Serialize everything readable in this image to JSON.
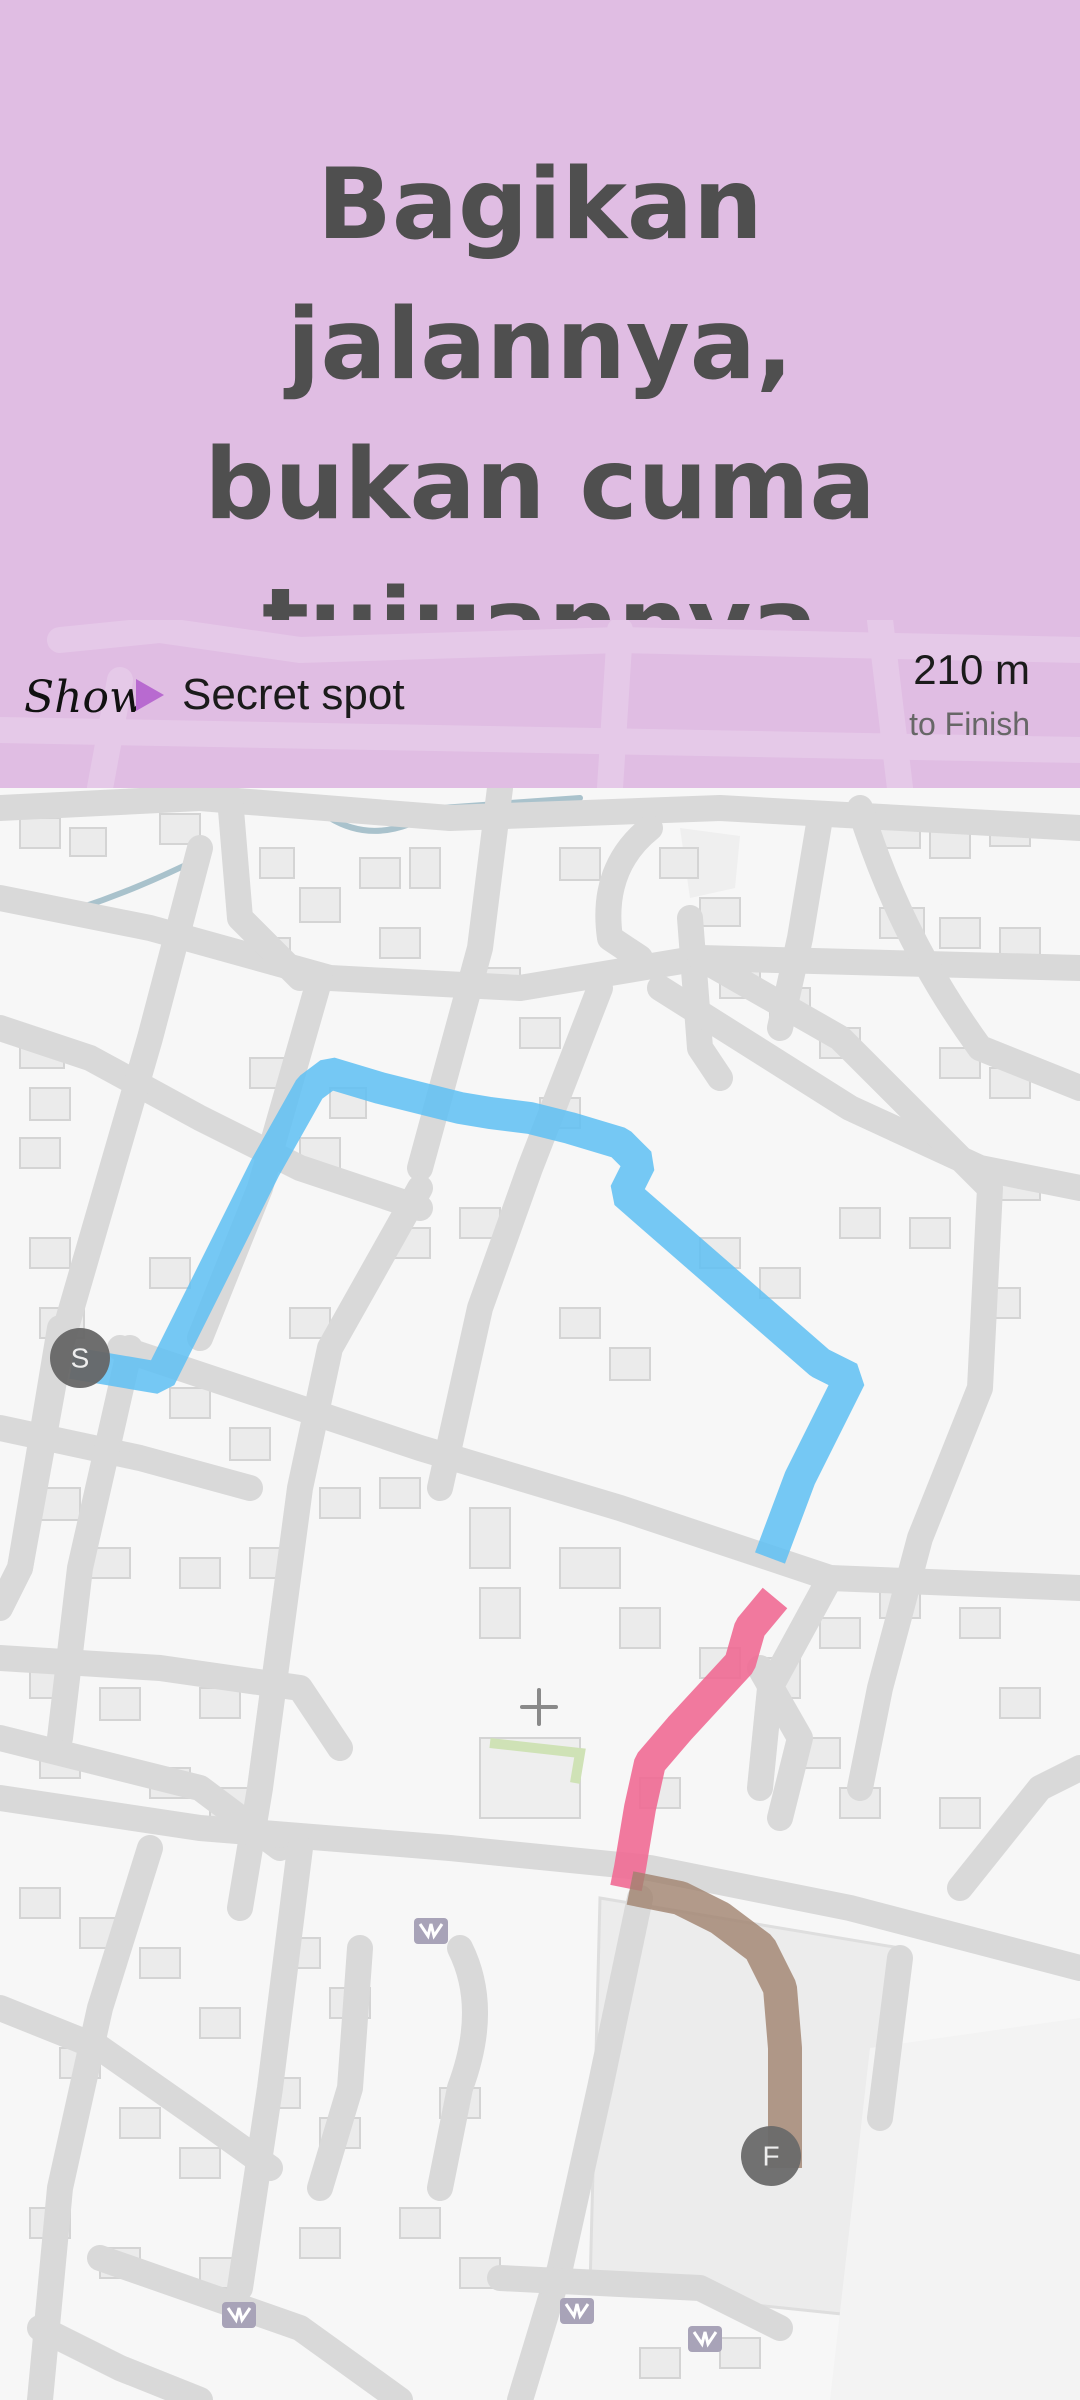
{
  "headline": {
    "line1": "Bagikan jalannya,",
    "line2": "bukan cuma",
    "line3": "tujuannya"
  },
  "info_bar": {
    "brand": "Show",
    "label": "Secret spot",
    "distance": "210 m",
    "distance_caption": "to Finish"
  },
  "map": {
    "start_marker": "S",
    "finish_marker": "F",
    "center_icon": "crosshair-icon",
    "poi_icon": "bookmark-icon",
    "route_colors": {
      "walked": "#5ec0f3",
      "current": "#ef6a93",
      "remaining": "#a0826e"
    }
  },
  "colors": {
    "background": "#e0bde3",
    "headline": "#4f4f4f",
    "map_road": "#dcdcdc",
    "map_building": "#e9e9e9"
  }
}
